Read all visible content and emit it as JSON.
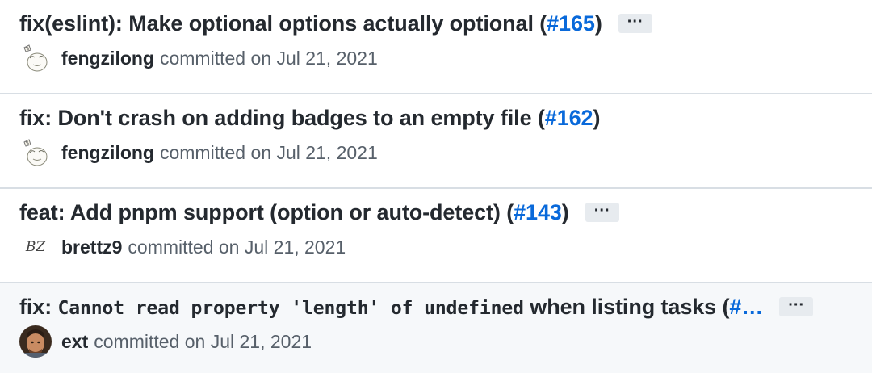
{
  "commits": [
    {
      "title_prefix": "fix(eslint): Make optional options actually optional (",
      "pr": "#165",
      "title_suffix": ")",
      "author": "fengzilong",
      "committed": "committed on",
      "date": "Jul 21, 2021",
      "ellipsis": "···"
    },
    {
      "title_prefix": "fix: Don't crash on adding badges to an empty file (",
      "pr": "#162",
      "title_suffix": ")",
      "author": "fengzilong",
      "committed": "committed on",
      "date": "Jul 21, 2021"
    },
    {
      "title_prefix": "feat: Add pnpm support (option or auto-detect) (",
      "pr": "#143",
      "title_suffix": ")",
      "author": "brettz9",
      "avatar_initials": "BZ",
      "committed": "committed on",
      "date": "Jul 21, 2021",
      "ellipsis": "···"
    },
    {
      "title_prefix": "fix: ",
      "title_code": "Cannot read property 'length' of undefined",
      "title_rest": " when listing tasks (",
      "pr": "#…",
      "author": "ext",
      "committed": "committed on",
      "date": "Jul 21, 2021",
      "ellipsis": "···"
    }
  ],
  "colors": {
    "link": "#0969da",
    "text": "#24292f",
    "muted": "#57606a",
    "divider": "#d8dee4",
    "button_bg": "#e7ebef"
  },
  "icons": {
    "avatar_fengzilong": "sketch-avatar-icon",
    "avatar_ext": "photo-avatar-icon"
  }
}
